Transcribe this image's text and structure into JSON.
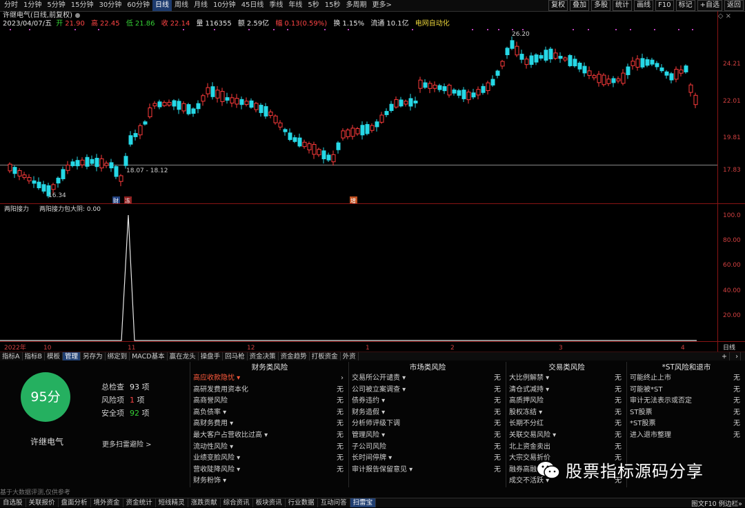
{
  "toolbar": {
    "periods": [
      "分时",
      "1分钟",
      "5分钟",
      "15分钟",
      "30分钟",
      "60分钟",
      "日线",
      "周线",
      "月线",
      "10分钟",
      "45日线",
      "季线",
      "年线",
      "5秒",
      "15秒",
      "多周期",
      "更多>"
    ],
    "active_period": "日线",
    "right_buttons": [
      "复权",
      "叠加",
      "多股",
      "统计",
      "画线",
      "F10",
      "标记",
      "+自选",
      "返回"
    ]
  },
  "header": {
    "title": "许继电气(日线,前复权)",
    "date": "2023/04/07/五",
    "open_label": "开",
    "open": "21.90",
    "high_label": "高",
    "high": "22.45",
    "low_label": "低",
    "low": "21.86",
    "close_label": "收",
    "close": "22.14",
    "volume_label": "量",
    "volume": "116355",
    "amount_label": "额",
    "amount": "2.59亿",
    "change_label": "幅",
    "change": "0.13(0.59%)",
    "turnover_label": "换",
    "turnover": "1.15%",
    "float_label": "流通",
    "float": "10.1亿",
    "concept": "电网自动化"
  },
  "price_chart": {
    "y_labels": [
      "24.21",
      "22.01",
      "19.81",
      "17.83"
    ],
    "high_marker": "26.20",
    "low_marker": "16.34",
    "range_label": "18.07 - 18.12",
    "event_labels": [
      "财",
      "冻",
      "增"
    ]
  },
  "indicator_chart": {
    "title": "两阳接力",
    "subtitle": "两阳接力包大阴: 0.00",
    "y_labels": [
      "100.0",
      "80.00",
      "60.00",
      "40.00",
      "20.00"
    ]
  },
  "x_axis": {
    "labels": [
      "2022年",
      "10",
      "11",
      "12",
      "1",
      "2",
      "3",
      "4"
    ],
    "mode": "日线"
  },
  "indicator_tabs": [
    "指标A",
    "指标B",
    "模板",
    "管理",
    "另存为",
    "绑定到",
    "MACD基本",
    "赢在龙头",
    "操盘手",
    "回马枪",
    "资金决策",
    "资金趋势",
    "打板资金",
    "外资"
  ],
  "active_indicator_tab": "管理",
  "scan": {
    "score": "95分",
    "stock_name": "许继电气",
    "total_label": "总检查",
    "total": "93",
    "total_unit": "项",
    "risk_label": "风险项",
    "risk": "1",
    "risk_unit": "项",
    "safe_label": "安全项",
    "safe": "92",
    "safe_unit": "项",
    "more": "更多扫雷避险 >",
    "disclaimer": "基于大数据评测,仅供参考"
  },
  "risk_columns": [
    {
      "title": "财务类风险",
      "items": [
        {
          "label": "高应收款隐忧 ▾",
          "status": "›",
          "alert": true
        },
        {
          "label": "高研发费用资本化",
          "status": "无"
        },
        {
          "label": "高商誉风险",
          "status": "无"
        },
        {
          "label": "高负债率 ▾",
          "status": "无"
        },
        {
          "label": "高财务费用 ▾",
          "status": "无"
        },
        {
          "label": "最大客户占营收比过高 ▾",
          "status": "无"
        },
        {
          "label": "流动性风险 ▾",
          "status": "无"
        },
        {
          "label": "业绩变脸风险 ▾",
          "status": "无"
        },
        {
          "label": "营收陡降风险 ▾",
          "status": "无"
        },
        {
          "label": "财务粉饰 ▾",
          "status": ""
        }
      ]
    },
    {
      "title": "市场类风险",
      "items": [
        {
          "label": "交易所公开谴责 ▾",
          "status": "无"
        },
        {
          "label": "公司被立案调查 ▾",
          "status": "无"
        },
        {
          "label": "债券违约 ▾",
          "status": "无"
        },
        {
          "label": "财务造假 ▾",
          "status": "无"
        },
        {
          "label": "分析师评级下调",
          "status": "无"
        },
        {
          "label": "管理风险 ▾",
          "status": "无"
        },
        {
          "label": "子公司风险",
          "status": "无"
        },
        {
          "label": "长时间停牌 ▾",
          "status": "无"
        },
        {
          "label": "审计报告保留意见 ▾",
          "status": "无"
        }
      ]
    },
    {
      "title": "交易类风险",
      "items": [
        {
          "label": "大比例解禁 ▾",
          "status": "无"
        },
        {
          "label": "清仓式减持 ▾",
          "status": "无"
        },
        {
          "label": "高质押风险",
          "status": "无"
        },
        {
          "label": "股权冻结 ▾",
          "status": "无"
        },
        {
          "label": "长期不分红",
          "status": "无"
        },
        {
          "label": "关联交易风险 ▾",
          "status": "无"
        },
        {
          "label": "北上资金卖出",
          "status": "无"
        },
        {
          "label": "大宗交易折价",
          "status": "无"
        },
        {
          "label": "融券高融",
          "status": ""
        },
        {
          "label": "成交不活跃 ▾",
          "status": "无"
        }
      ]
    },
    {
      "title": "*ST风险和退市",
      "items": [
        {
          "label": "可能终止上市",
          "status": "无"
        },
        {
          "label": "可能被*ST",
          "status": "无"
        },
        {
          "label": "审计无法表示或否定",
          "status": "无"
        },
        {
          "label": "ST股票",
          "status": "无"
        },
        {
          "label": "*ST股票",
          "status": "无"
        },
        {
          "label": "进入退市整理",
          "status": "无"
        }
      ]
    }
  ],
  "bottom_nav": [
    "自选股",
    "关联报价",
    "盘面分析",
    "境外资金",
    "资金统计",
    "短线精灵",
    "涨跌贡献",
    "综合资讯",
    "板块资讯",
    "行业数据",
    "互动问答",
    "扫雷宝"
  ],
  "active_bottom": "扫雷宝",
  "bottom_right": "图文F10 例边栏»",
  "watermark": "股票指标源码分享",
  "colors": {
    "up": "#ff3b3b",
    "down": "#26d8e6",
    "score_bg": "#25b060",
    "alert": "#ff5a3c"
  }
}
